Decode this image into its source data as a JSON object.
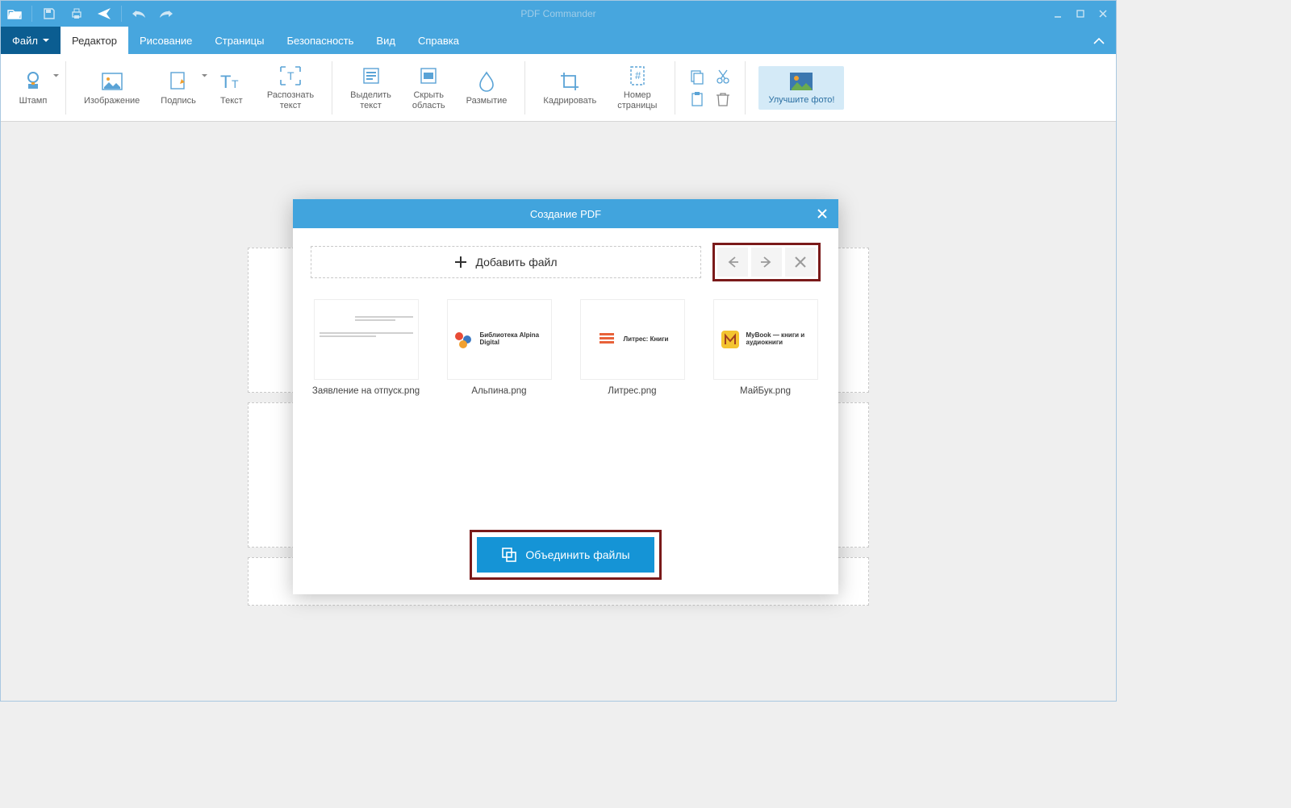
{
  "app": {
    "title": "PDF Commander"
  },
  "menu": {
    "file": "Файл",
    "editor": "Редактор",
    "drawing": "Рисование",
    "pages": "Страницы",
    "security": "Безопасность",
    "view": "Вид",
    "help": "Справка"
  },
  "ribbon": {
    "stamp": "Штамп",
    "image": "Изображение",
    "signature": "Подпись",
    "text": "Текст",
    "ocr": "Распознать\nтекст",
    "highlight": "Выделить\nтекст",
    "hide": "Скрыть\nобласть",
    "blur": "Размытие",
    "crop": "Кадрировать",
    "pagenum": "Номер\nстраницы",
    "promo": "Улучшите фото!"
  },
  "dialog": {
    "title": "Создание PDF",
    "add_file": "Добавить файл",
    "merge": "Объединить файлы",
    "files": [
      {
        "name": "Заявление на отпуск.png",
        "brand": ""
      },
      {
        "name": "Альпина.png",
        "brand": "Библиотека Alpina Digital"
      },
      {
        "name": "Литрес.png",
        "brand": "Литрес: Книги"
      },
      {
        "name": "МайБук.png",
        "brand": "MyBook — книги и аудиокниги"
      }
    ]
  }
}
